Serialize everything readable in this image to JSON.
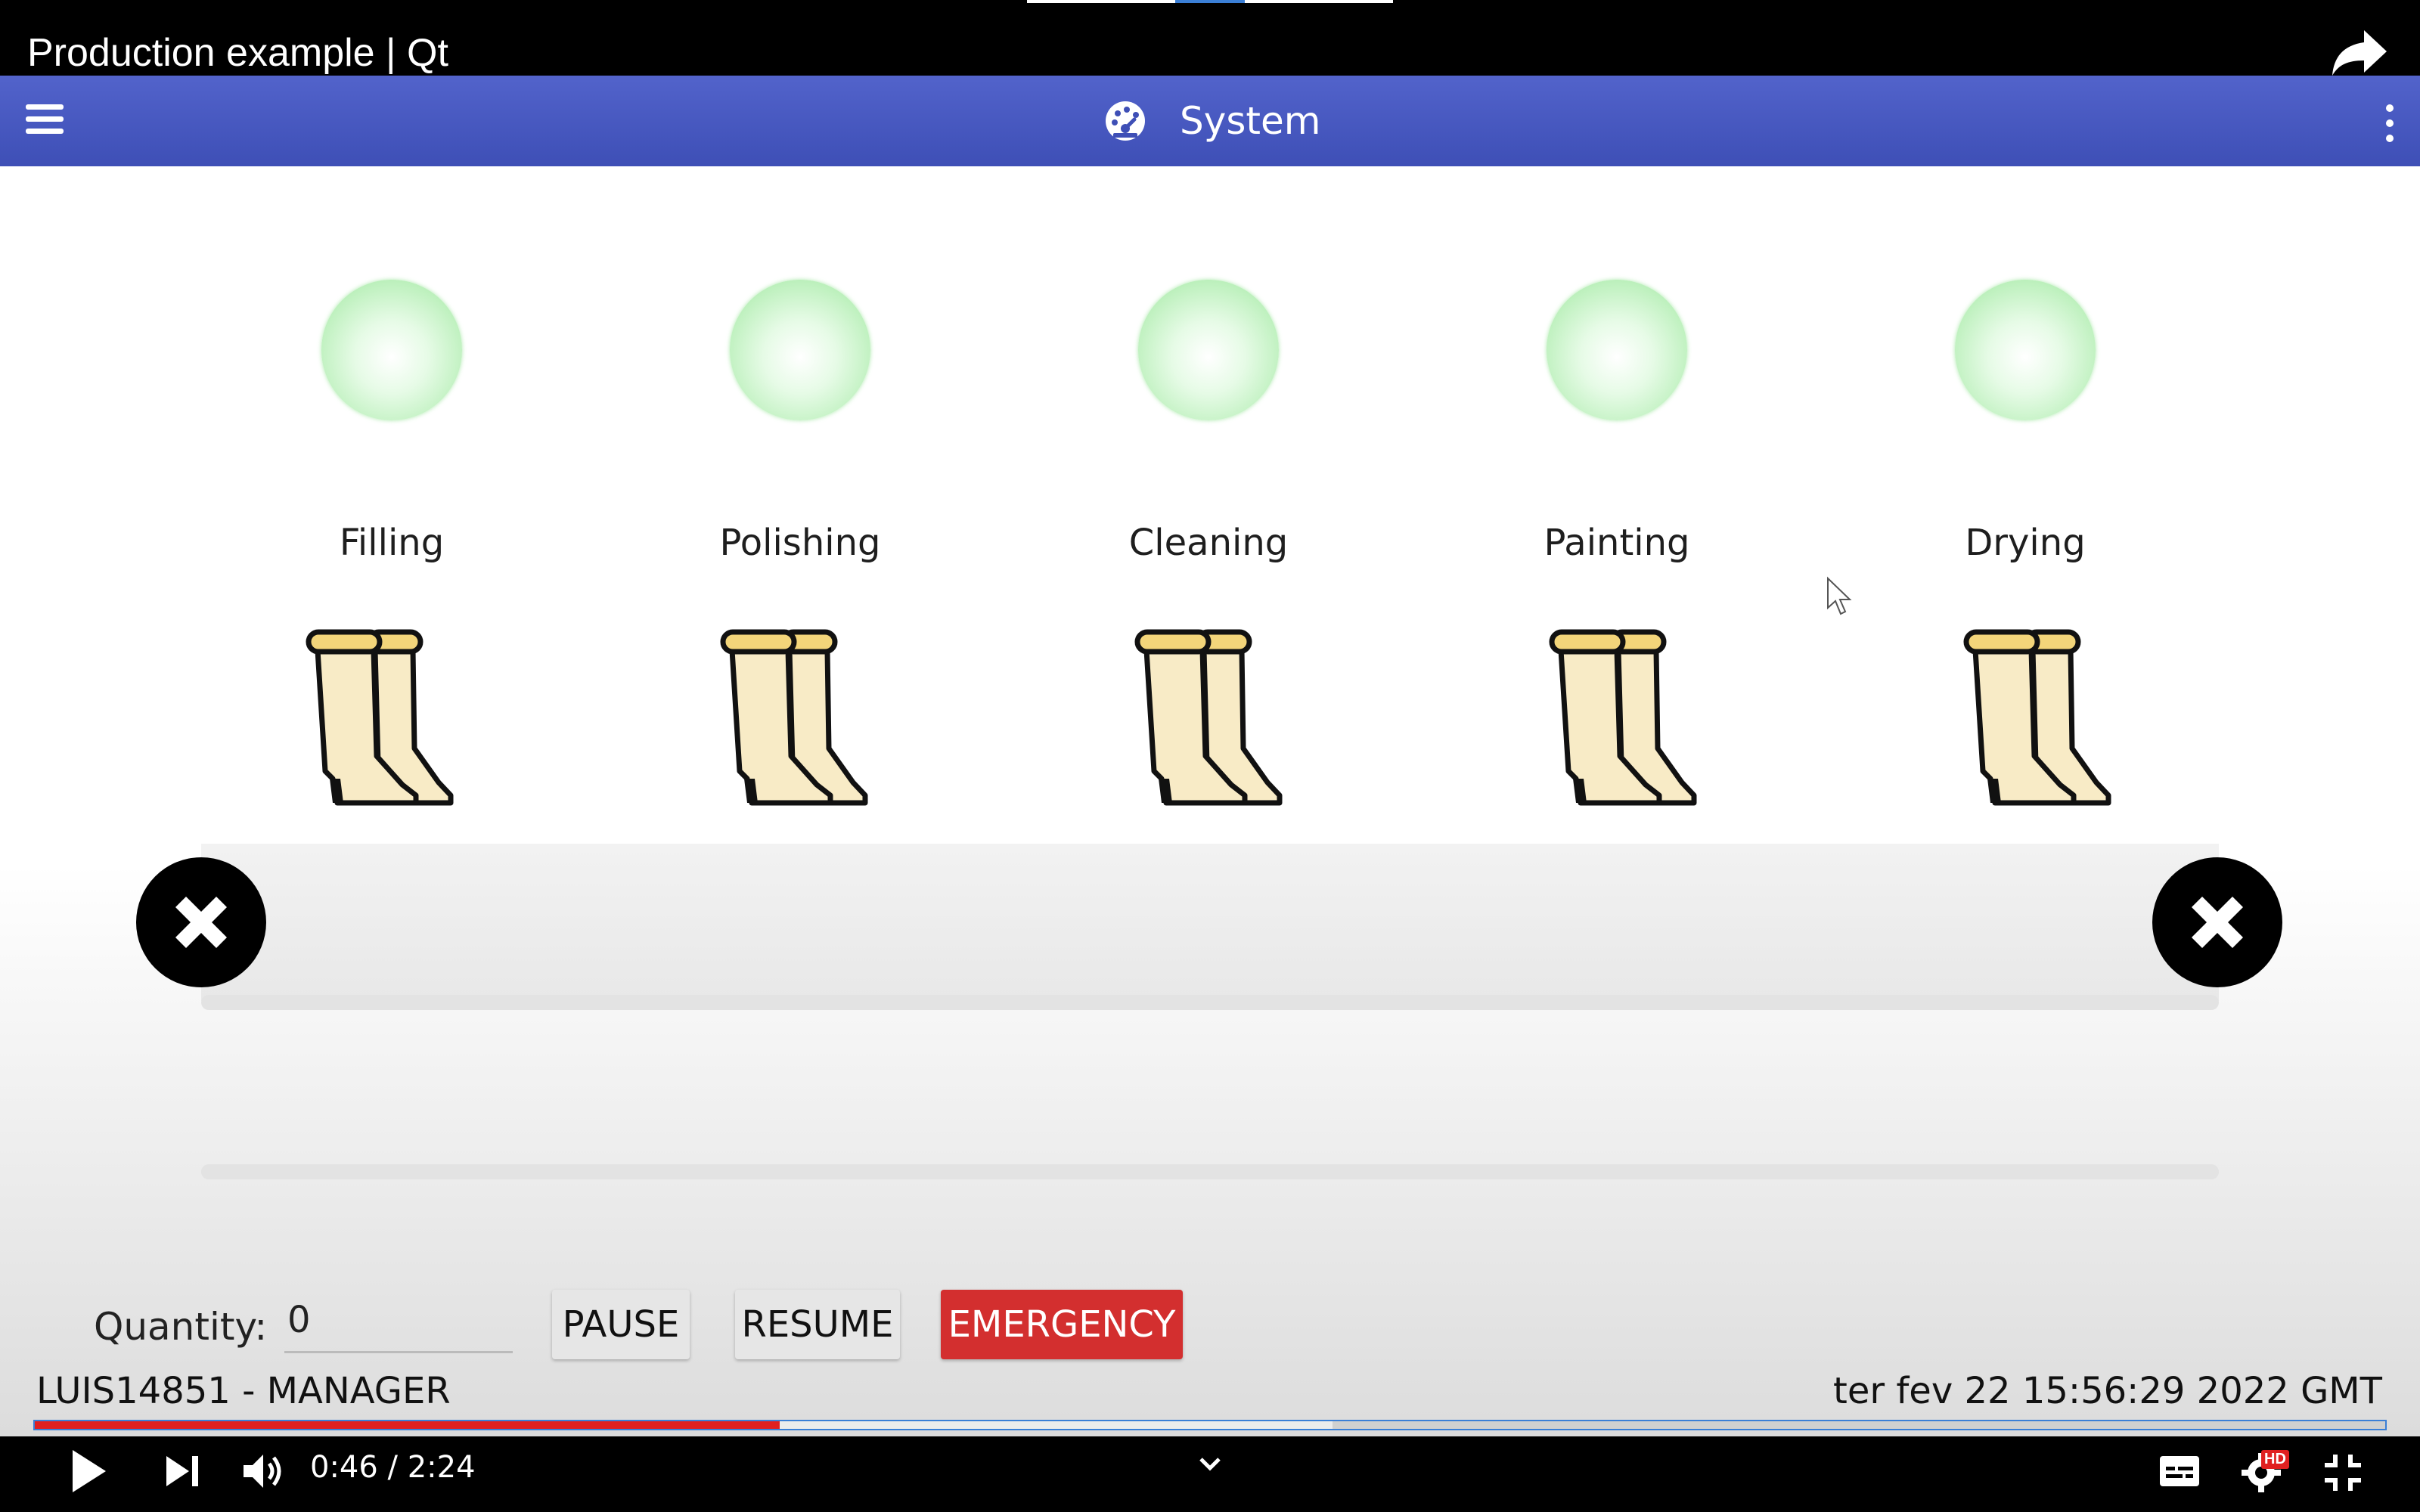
{
  "video": {
    "title": "Production example | Qt",
    "time": "0:46 / 2:24",
    "progress_played": 0.317,
    "progress_buffered": 0.552,
    "hd_badge": "HD"
  },
  "header": {
    "title": "System",
    "icon": "gauge-icon",
    "color": "#3f51b5"
  },
  "stations": [
    {
      "label": "Filling",
      "status_color": "#9ae69a"
    },
    {
      "label": "Polishing",
      "status_color": "#9ae69a"
    },
    {
      "label": "Cleaning",
      "status_color": "#9ae69a"
    },
    {
      "label": "Painting",
      "status_color": "#9ae69a"
    },
    {
      "label": "Drying",
      "status_color": "#9ae69a"
    }
  ],
  "products": [
    {
      "icon": "boots-icon"
    },
    {
      "icon": "boots-icon"
    },
    {
      "icon": "boots-icon"
    },
    {
      "icon": "boots-icon"
    },
    {
      "icon": "boots-icon"
    }
  ],
  "conveyor": {
    "left_button_icon": "close-icon",
    "right_button_icon": "close-icon"
  },
  "controls": {
    "quantity_label": "Quantity:",
    "quantity_value": "0",
    "pause_label": "PAUSE",
    "resume_label": "RESUME",
    "emergency_label": "EMERGENCY",
    "emergency_color": "#d32f2f"
  },
  "status_bar": {
    "user": "LUIS14851 - MANAGER",
    "datetime": "ter fev 22 15:56:29 2022 GMT"
  }
}
